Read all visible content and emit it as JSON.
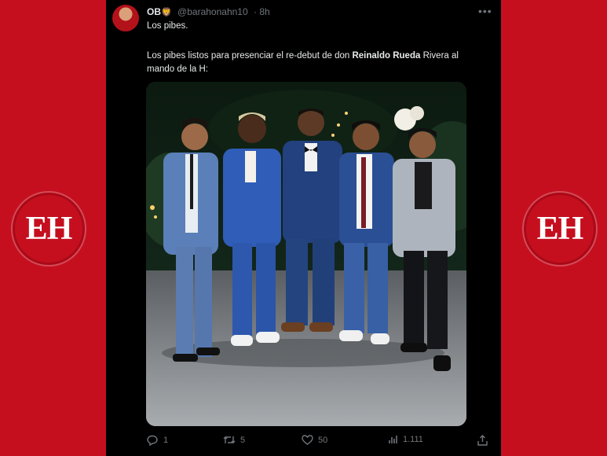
{
  "branding": {
    "logo_text": "EH",
    "brand_color": "#c50f1f"
  },
  "tweet": {
    "author": {
      "name": "OB",
      "badge_emoji": "🦁",
      "handle": "@barahonahn10",
      "time": "8h"
    },
    "text_line1": "Los pibes.",
    "text_part_a": "Los pibes listos para presenciar el re-debut de don ",
    "text_bold": "Reinaldo Rueda",
    "text_part_b": " Rivera al mando de la H:",
    "actions": {
      "replies": "1",
      "retweets": "5",
      "likes": "50",
      "views": "1.111"
    },
    "icons": [
      "reply-icon",
      "retweet-icon",
      "like-icon",
      "views-icon",
      "share-icon",
      "more-options-icon"
    ]
  }
}
